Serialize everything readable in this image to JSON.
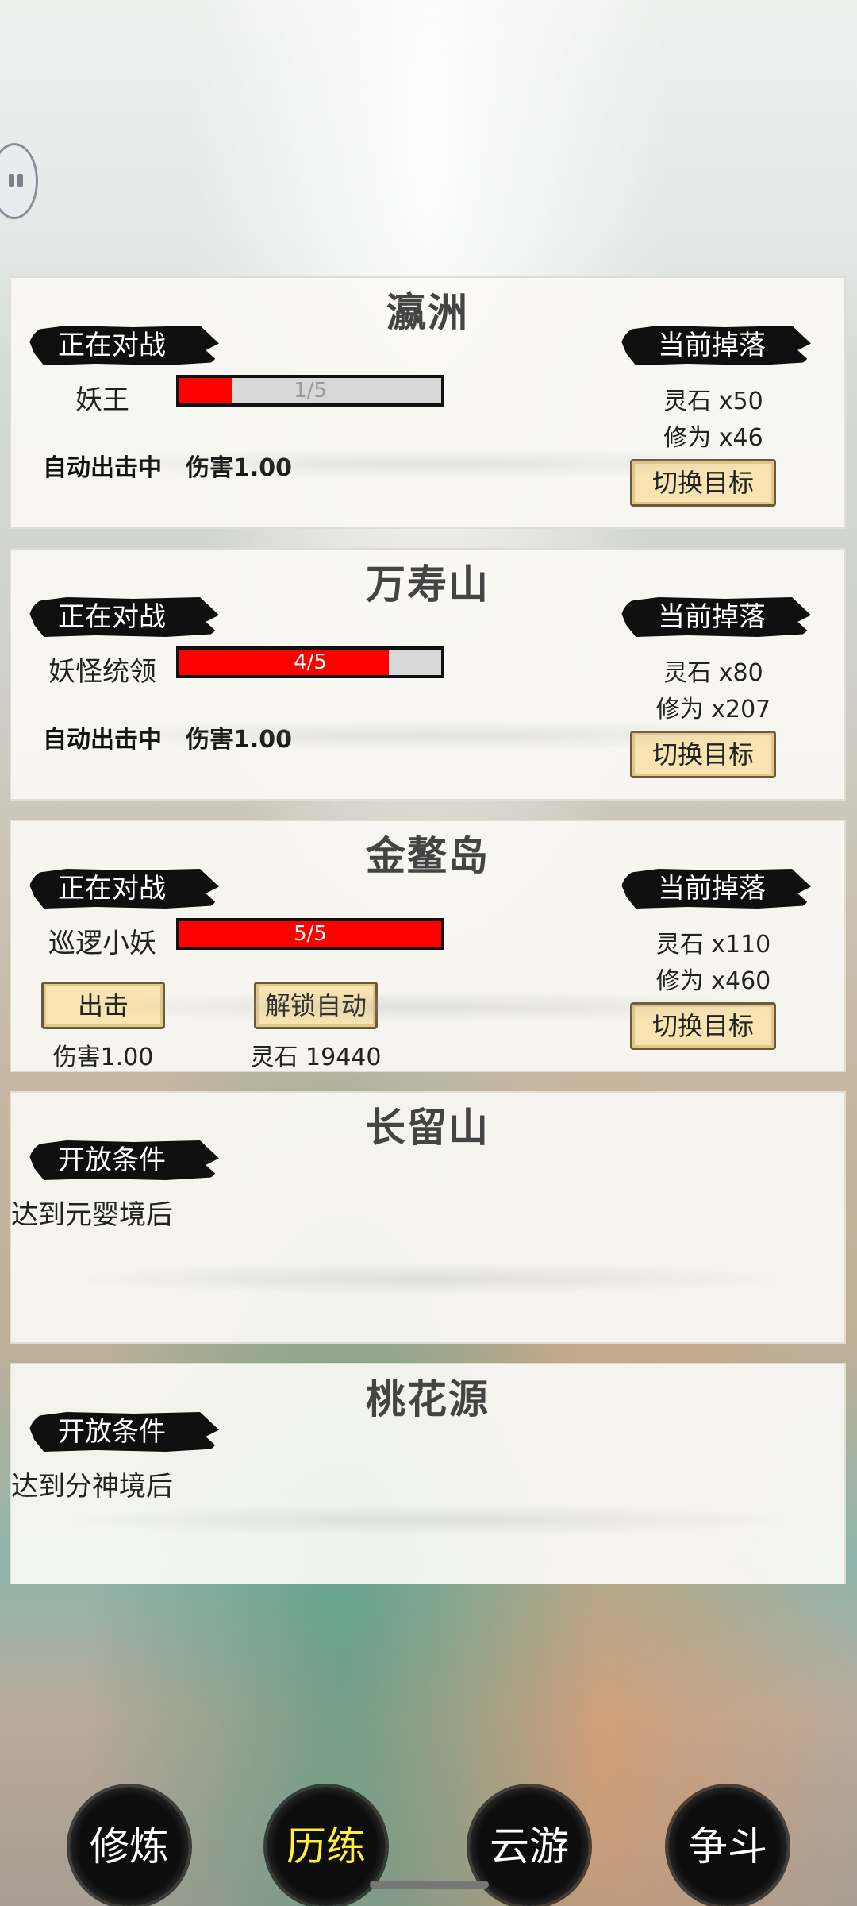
{
  "cards": [
    {
      "title": "瀛洲",
      "battle_label": "正在对战",
      "drop_label": "当前掉落",
      "enemy": "妖王",
      "hp_text": "1/5",
      "hp_fraction": 0.2,
      "drops": [
        "灵石 x50",
        "修为 x46"
      ],
      "switch_label": "切换目标",
      "auto_label": "自动出击中",
      "damage_label": "伤害1.00"
    },
    {
      "title": "万寿山",
      "battle_label": "正在对战",
      "drop_label": "当前掉落",
      "enemy": "妖怪统领",
      "hp_text": "4/5",
      "hp_fraction": 0.8,
      "drops": [
        "灵石 x80",
        "修为 x207"
      ],
      "switch_label": "切换目标",
      "auto_label": "自动出击中",
      "damage_label": "伤害1.00"
    },
    {
      "title": "金鳌岛",
      "battle_label": "正在对战",
      "drop_label": "当前掉落",
      "enemy": "巡逻小妖",
      "hp_text": "5/5",
      "hp_fraction": 1.0,
      "drops": [
        "灵石 x110",
        "修为 x460"
      ],
      "switch_label": "切换目标",
      "attack_label": "出击",
      "unlock_auto_label": "解锁自动",
      "damage_label": "伤害1.00",
      "unlock_cost": "灵石 19440"
    },
    {
      "title": "长留山",
      "condition_label": "开放条件",
      "condition": "达到元婴境后"
    },
    {
      "title": "桃花源",
      "condition_label": "开放条件",
      "condition": "达到分神境后"
    }
  ],
  "nav": {
    "items": [
      "修炼",
      "历练",
      "云游",
      "争斗"
    ],
    "active": "历练"
  },
  "colors": {
    "hp_fill": "#ff0000",
    "nav_active": "#ffef3a"
  }
}
